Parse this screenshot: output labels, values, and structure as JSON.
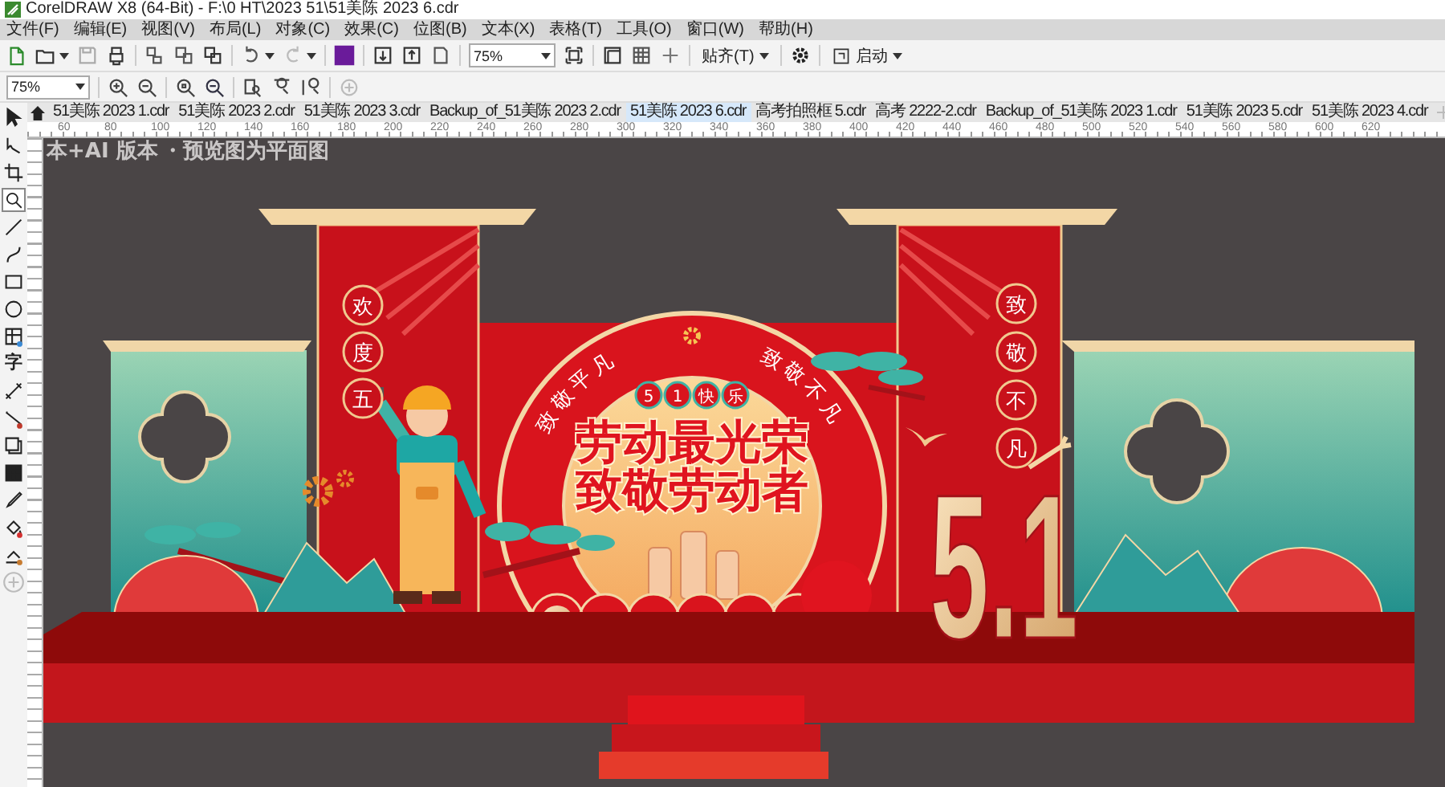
{
  "window": {
    "title": "CorelDRAW X8 (64-Bit) - F:\\0 HT\\2023 51\\51美陈 2023 6.cdr"
  },
  "menu": [
    "文件(F)",
    "编辑(E)",
    "视图(V)",
    "布局(L)",
    "对象(C)",
    "效果(C)",
    "位图(B)",
    "文本(X)",
    "表格(T)",
    "工具(O)",
    "窗口(W)",
    "帮助(H)"
  ],
  "toolbar": {
    "zoom": "75%",
    "snap": "贴齐(T)",
    "launch": "启动"
  },
  "property_bar": {
    "zoom": "75%"
  },
  "toolbox": [
    {
      "selected": false
    },
    {
      "selected": false
    },
    {
      "selected": false
    },
    {
      "selected": true
    },
    {
      "selected": false
    },
    {
      "selected": false
    },
    {
      "selected": false
    },
    {
      "selected": false
    },
    {
      "selected": false
    },
    {
      "selected": false,
      "glyph": "字"
    },
    {
      "selected": false
    },
    {
      "selected": false
    },
    {
      "selected": false
    },
    {
      "selected": false
    },
    {
      "selected": false
    },
    {
      "selected": false
    },
    {
      "selected": false
    }
  ],
  "tabs": [
    {
      "label": "51美陈 2023 1.cdr",
      "selected": false
    },
    {
      "label": "51美陈 2023 2.cdr",
      "selected": false
    },
    {
      "label": "51美陈 2023 3.cdr",
      "selected": false
    },
    {
      "label": "Backup_of_51美陈 2023 2.cdr",
      "selected": false
    },
    {
      "label": "51美陈 2023 6.cdr",
      "selected": true
    },
    {
      "label": "高考拍照框 5.cdr",
      "selected": false
    },
    {
      "label": "高考 2222-2.cdr",
      "selected": false
    },
    {
      "label": "Backup_of_51美陈 2023 1.cdr",
      "selected": false
    },
    {
      "label": "51美陈 2023 5.cdr",
      "selected": false
    },
    {
      "label": "51美陈 2023 4.cdr",
      "selected": false
    }
  ],
  "ruler": {
    "labels": [
      "60",
      "80",
      "100",
      "120",
      "140",
      "160",
      "180",
      "200",
      "220",
      "240",
      "260",
      "280",
      "300",
      "320",
      "340",
      "360",
      "380",
      "400",
      "420",
      "440",
      "460",
      "480",
      "500",
      "520",
      "540",
      "560",
      "580",
      "600",
      "620"
    ]
  },
  "canvas": {
    "notes": [
      "本+AI 版本",
      "・预览图为平面图"
    ],
    "artwork": {
      "left_banner": [
        "欢",
        "度",
        "五"
      ],
      "right_banner": [
        "致",
        "敬",
        "不",
        "凡"
      ],
      "arc_texts": [
        "致敬平凡",
        "致敬不凡"
      ],
      "badge": [
        "5",
        "1",
        "快",
        "乐"
      ],
      "headline": [
        "劳动最光荣",
        "致敬劳动者"
      ],
      "big_number": "5.1"
    }
  }
}
